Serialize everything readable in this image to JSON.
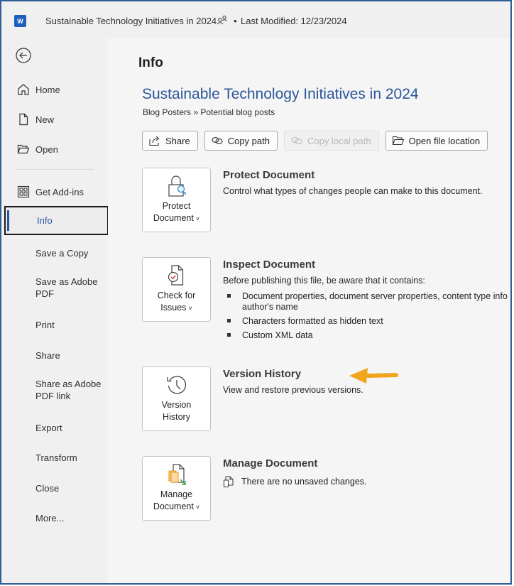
{
  "titlebar": {
    "app_icon": "word-logo-icon",
    "app_letter": "W",
    "document_name": "Sustainable Technology Initiatives in 2024",
    "shared_icon": "people-icon",
    "separator": "•",
    "last_modified": "Last Modified: 12/23/2024"
  },
  "sidebar": {
    "back_icon": "back-arrow-icon",
    "items": [
      {
        "label": "Home",
        "icon": "home-icon"
      },
      {
        "label": "New",
        "icon": "new-document-icon"
      },
      {
        "label": "Open",
        "icon": "folder-open-icon"
      },
      {
        "label": "Get Add-ins",
        "icon": "add-ins-grid-icon"
      },
      {
        "label": "Info",
        "active": true
      },
      {
        "label": "Save a Copy"
      },
      {
        "label": "Save as Adobe\nPDF"
      },
      {
        "label": "Print"
      },
      {
        "label": "Share"
      },
      {
        "label": "Share as Adobe\nPDF link"
      },
      {
        "label": "Export"
      },
      {
        "label": "Transform"
      },
      {
        "label": "Close"
      },
      {
        "label": "More..."
      }
    ]
  },
  "main": {
    "page_title": "Info",
    "doc_title": "Sustainable Technology Initiatives in 2024",
    "breadcrumb": "Blog Posters » Potential blog posts",
    "actions": [
      {
        "label": "Share",
        "icon": "share-icon",
        "enabled": true
      },
      {
        "label": "Copy path",
        "icon": "link-icon",
        "enabled": true
      },
      {
        "label": "Copy local path",
        "icon": "link-icon",
        "enabled": false
      },
      {
        "label": "Open file location",
        "icon": "folder-open-icon",
        "enabled": true
      }
    ],
    "sections": {
      "protect": {
        "tile_line1": "Protect",
        "tile_line2": "Document",
        "title": "Protect Document",
        "description": "Control what types of changes people can make to this document."
      },
      "inspect": {
        "tile_line1": "Check for",
        "tile_line2": "Issues",
        "title": "Inspect Document",
        "description": "Before publishing this file, be aware that it contains:",
        "bullets": [
          "Document properties, document server properties, content type info",
          "author's name",
          "Characters formatted as hidden text",
          "Custom XML data"
        ]
      },
      "version": {
        "tile_line1": "Version",
        "tile_line2": "History",
        "title": "Version History",
        "description": "View and restore previous versions.",
        "annotation": "orange-arrow-pointing-left",
        "annotation_color": "#f0a51c"
      },
      "manage": {
        "tile_line1": "Manage",
        "tile_line2": "Document",
        "title": "Manage Document",
        "status": "There are no unsaved changes."
      }
    },
    "chevron": "˅"
  },
  "colors": {
    "accent": "#2b579a",
    "frame_border": "#2f5f94",
    "sidebar_bg": "#f0f0f0",
    "main_bg": "#f5f5f5"
  }
}
